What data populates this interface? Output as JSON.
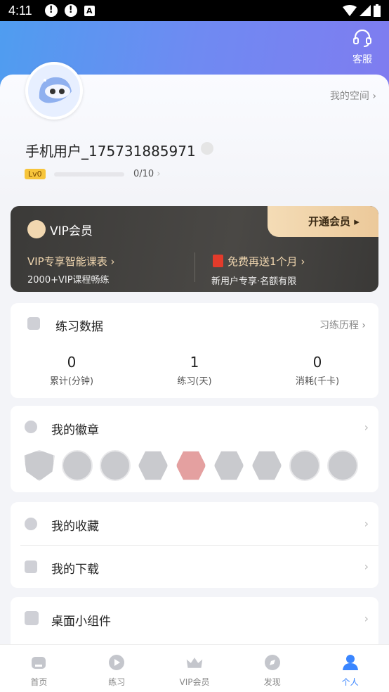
{
  "status_bar": {
    "time": "4:11"
  },
  "header": {
    "service_label": "客服"
  },
  "profile": {
    "my_space": "我的空间",
    "username": "手机用户_175731885971",
    "level": "Lv0",
    "level_progress_text": "0/10",
    "level_progress": 0
  },
  "vip": {
    "title": "VIP会员",
    "open_button": "开通会员",
    "left_title": "VIP专享智能课表",
    "left_sub": "2000+VIP课程畅练",
    "right_title": "免费再送1个月",
    "right_sub": "新用户专享·名额有限"
  },
  "practice": {
    "title": "练习数据",
    "history_link": "习练历程",
    "stats": [
      {
        "value": "0",
        "caption": "累计(分钟)"
      },
      {
        "value": "1",
        "caption": "练习(天)"
      },
      {
        "value": "0",
        "caption": "消耗(千卡)"
      }
    ]
  },
  "badges": {
    "title": "我的徽章"
  },
  "favorites": {
    "title": "我的收藏"
  },
  "downloads": {
    "title": "我的下载"
  },
  "widgets": {
    "title": "桌面小组件"
  },
  "tabs": [
    {
      "label": "首页"
    },
    {
      "label": "练习"
    },
    {
      "label": "VIP会员"
    },
    {
      "label": "发现"
    },
    {
      "label": "个人"
    }
  ],
  "colors": {
    "accent": "#3a86ff",
    "vip_gold": "#f1d7b0",
    "level_badge": "#f7c53b"
  }
}
